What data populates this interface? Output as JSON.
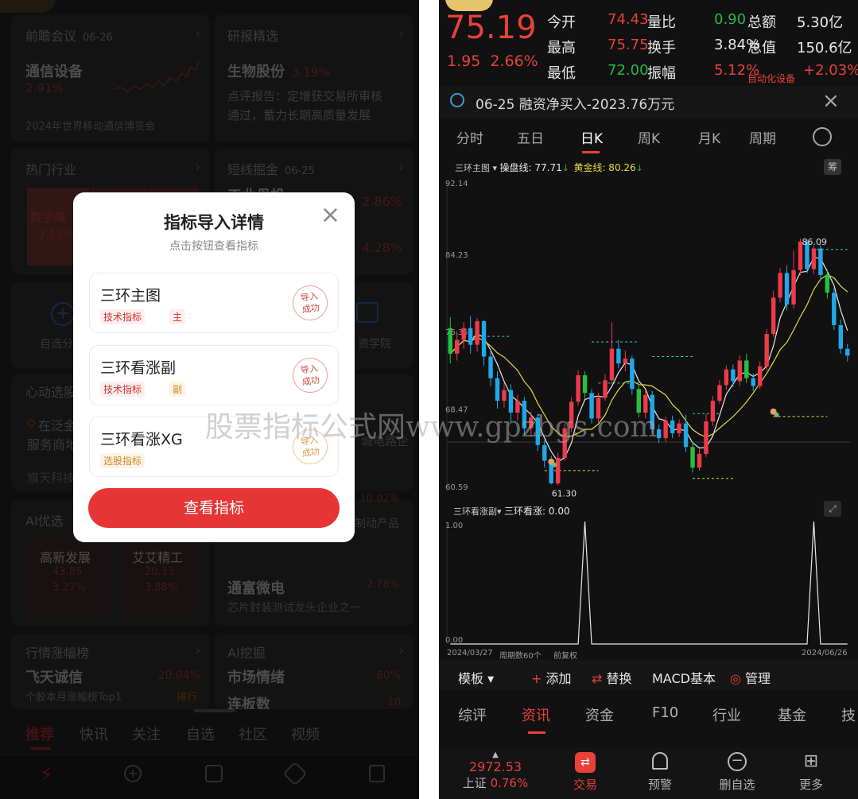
{
  "left": {
    "card_meeting": {
      "title": "前瞻会议",
      "date": "06-26",
      "name": "通信设备",
      "pct": "2.91%",
      "desc": "2024年世界移动通信博览会"
    },
    "card_research": {
      "title": "研报精选",
      "name": "生物股份",
      "pct": "3.19%",
      "desc1": "点评报告：定增获交易所审核",
      "desc2": "通过，蓄力长期高质量发展"
    },
    "card_hot": {
      "title": "热门行业",
      "name": "数字媒",
      "pct": "7.17%"
    },
    "card_short": {
      "title": "短线掘金",
      "date": "06-25",
      "name": "工业母机",
      "pct1": "2.86%",
      "pct2": "4.28%"
    },
    "icons": {
      "left_label": "自选分",
      "right_label": "资学院"
    },
    "card_select": {
      "title": "心动选股",
      "line1": "在泛金",
      "line2": "服务商地",
      "line3": "旗天科技",
      "right1": "城电路企"
    },
    "card_ai": {
      "title": "AI优选",
      "s1_name": "高新发展",
      "s1_val": "43.85",
      "s1_pct": "3.27%",
      "s2_name": "艾艾精工",
      "s2_val": "20.33",
      "s2_pct": "3.88%",
      "r_pct": "10.02%",
      "r_desc": "制动产品"
    },
    "card_tongfu": {
      "name": "通富微电",
      "pct": "2.78%",
      "desc": "芯片封装测试龙头企业之一"
    },
    "card_rank": {
      "title": "行情涨幅榜",
      "name": "飞天诚信",
      "pct": "20.04%",
      "desc": "个股本月涨幅榜Top1",
      "badge": "排行"
    },
    "card_aimine": {
      "title": "AI挖掘",
      "name": "市场情绪",
      "pct": "80%",
      "name2": "连板数",
      "val2": "10"
    },
    "tabs": [
      "推荐",
      "快讯",
      "关注",
      "自选",
      "社区",
      "视频"
    ],
    "modal": {
      "title": "指标导入详情",
      "subtitle": "点击按钮查看指标",
      "items": [
        {
          "name": "三环主图",
          "tag1": "技术指标",
          "tag2": "主",
          "stamp1": "导入",
          "stamp2": "成功"
        },
        {
          "name": "三环看涨副",
          "tag1": "技术指标",
          "tag2": "副",
          "stamp1": "导入",
          "stamp2": "成功"
        },
        {
          "name": "三环看涨XG",
          "tag1": "选股指标",
          "stamp1": "导入",
          "stamp2": "成功"
        }
      ],
      "button": "查看指标"
    }
  },
  "watermark": "股票指标公式网www.gpzbgs.com",
  "right": {
    "price": "75.19",
    "change": "1.95",
    "change_pct": "2.66%",
    "stats": [
      {
        "l": "今开",
        "v": "74.43",
        "l2": "量比",
        "v2": "0.90",
        "l3": "总额",
        "v3": "5.30亿"
      },
      {
        "l": "最高",
        "v": "75.75",
        "l2": "换手",
        "v2": "3.84%",
        "l3": "总值",
        "v3": "150.6亿"
      },
      {
        "l": "最低",
        "v": "72.00",
        "l2": "振幅",
        "v2": "5.12%",
        "l3": "自动化设备",
        "v3": "+2.03%"
      }
    ],
    "notice": "06-25 融资净买入-2023.76万元",
    "tabs": [
      "分时",
      "五日",
      "日K",
      "周K",
      "月K",
      "周期"
    ],
    "active_tab": "日K",
    "indicator_main": "三环主图",
    "line1_label": "操盘线: 77.71",
    "line2_label": "黄金线: 80.26",
    "chou": "筹",
    "sub_name": "三环看涨副",
    "sub_label": "三环看涨: 0.00",
    "sub_max": "1.00",
    "sub_min": "0.00",
    "date_start": "2024/03/27",
    "period": "周期数60个",
    "fq": "前复权",
    "date_end": "2024/06/26",
    "toolbar": {
      "template": "模板",
      "add": "添加",
      "replace": "替换",
      "macd": "MACD基本",
      "manage": "管理"
    },
    "bottom_tabs": [
      "综评",
      "资讯",
      "资金",
      "F10",
      "行业",
      "基金",
      "技"
    ],
    "active_bottom": "资讯",
    "nav": {
      "index_val": "2972.53",
      "index_name": "上证",
      "index_pct": "0.76%",
      "trade": "交易",
      "alert": "预警",
      "del": "删自选",
      "more": "更多"
    }
  },
  "chart_data": {
    "type": "candlestick",
    "title": "",
    "y_ticks": [
      "92.14",
      "84.23",
      "76.35",
      "68.47",
      "60.59"
    ],
    "ylim": [
      60.59,
      92.14
    ],
    "high_label": "86.09",
    "low_label": "61.30",
    "candles": [
      [
        77.2,
        74.6,
        78.3,
        73.6
      ],
      [
        74.6,
        76.0,
        76.9,
        73.9
      ],
      [
        76.0,
        77.2,
        77.8,
        75.1
      ],
      [
        77.2,
        75.5,
        78.4,
        74.6
      ],
      [
        75.5,
        77.9,
        78.2,
        74.8
      ],
      [
        77.9,
        74.3,
        78.0,
        73.4
      ],
      [
        74.3,
        72.1,
        75.0,
        71.3
      ],
      [
        72.1,
        69.8,
        72.8,
        69.0
      ],
      [
        69.8,
        70.9,
        71.6,
        69.1
      ],
      [
        70.9,
        68.6,
        71.5,
        67.7
      ],
      [
        68.6,
        69.8,
        70.4,
        67.8
      ],
      [
        69.8,
        67.0,
        70.2,
        66.3
      ],
      [
        67.0,
        68.1,
        68.7,
        66.2
      ],
      [
        68.1,
        65.3,
        68.5,
        64.7
      ],
      [
        65.3,
        63.7,
        65.8,
        63.0
      ],
      [
        63.7,
        61.4,
        64.2,
        61.3
      ],
      [
        61.4,
        64.0,
        64.5,
        61.2
      ],
      [
        64.0,
        67.0,
        67.5,
        63.7
      ],
      [
        67.0,
        69.7,
        70.2,
        66.6
      ],
      [
        69.7,
        72.4,
        72.9,
        69.3
      ],
      [
        72.4,
        70.6,
        72.8,
        70.0
      ],
      [
        70.6,
        68.0,
        71.0,
        67.5
      ],
      [
        68.0,
        70.1,
        70.6,
        67.6
      ],
      [
        70.1,
        71.9,
        72.5,
        69.8
      ],
      [
        71.9,
        75.1,
        77.8,
        71.5
      ],
      [
        75.1,
        73.6,
        76.0,
        73.1
      ],
      [
        73.6,
        74.1,
        74.9,
        72.8
      ],
      [
        74.1,
        71.0,
        74.4,
        70.4
      ],
      [
        71.0,
        68.6,
        71.5,
        68.1
      ],
      [
        68.6,
        70.4,
        70.9,
        68.0
      ],
      [
        70.4,
        66.9,
        70.8,
        66.5
      ],
      [
        66.9,
        66.0,
        67.4,
        65.5
      ],
      [
        66.0,
        67.8,
        68.2,
        65.6
      ],
      [
        67.8,
        66.5,
        68.3,
        66.0
      ],
      [
        66.5,
        67.5,
        67.9,
        66.1
      ],
      [
        67.5,
        65.1,
        68.4,
        64.6
      ],
      [
        65.1,
        63.0,
        65.6,
        62.5
      ],
      [
        63.0,
        64.4,
        64.9,
        62.7
      ],
      [
        64.4,
        67.7,
        68.5,
        64.1
      ],
      [
        67.7,
        69.8,
        70.3,
        67.3
      ],
      [
        69.8,
        71.4,
        71.9,
        69.5
      ],
      [
        71.4,
        73.0,
        73.4,
        70.9
      ],
      [
        73.0,
        71.8,
        73.5,
        71.2
      ],
      [
        71.8,
        73.9,
        74.4,
        71.3
      ],
      [
        73.9,
        72.1,
        74.6,
        71.6
      ],
      [
        72.1,
        71.3,
        72.6,
        70.8
      ],
      [
        71.3,
        73.3,
        73.8,
        71.0
      ],
      [
        73.3,
        76.6,
        77.1,
        72.9
      ],
      [
        76.6,
        80.3,
        81.0,
        76.3
      ],
      [
        80.3,
        82.8,
        83.3,
        79.8
      ],
      [
        82.8,
        79.6,
        83.6,
        79.0
      ],
      [
        79.6,
        83.1,
        85.1,
        79.2
      ],
      [
        83.1,
        86.0,
        86.3,
        82.6
      ],
      [
        86.0,
        83.2,
        86.2,
        82.8
      ],
      [
        83.2,
        85.3,
        85.6,
        82.7
      ],
      [
        85.3,
        82.6,
        85.7,
        82.1
      ],
      [
        82.6,
        80.8,
        83.2,
        80.2
      ],
      [
        80.8,
        77.5,
        81.3,
        77.0
      ],
      [
        77.5,
        75.1,
        78.1,
        74.6
      ],
      [
        75.1,
        74.4,
        75.6,
        73.8
      ]
    ],
    "sub_peaks": [
      20,
      54
    ]
  }
}
